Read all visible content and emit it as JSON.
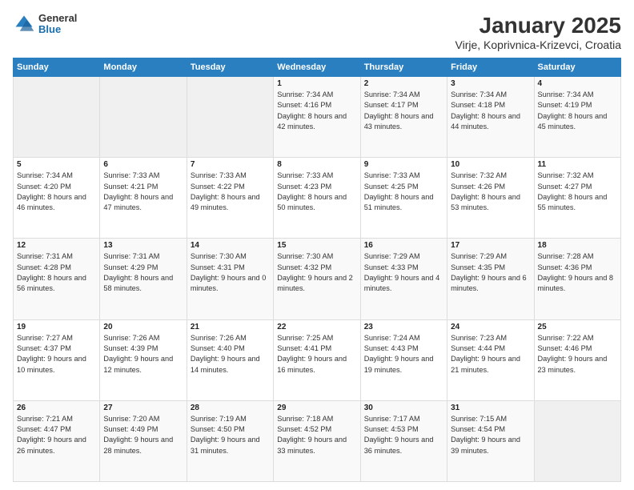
{
  "header": {
    "logo_general": "General",
    "logo_blue": "Blue",
    "title": "January 2025",
    "subtitle": "Virje, Koprivnica-Krizevci, Croatia"
  },
  "days_of_week": [
    "Sunday",
    "Monday",
    "Tuesday",
    "Wednesday",
    "Thursday",
    "Friday",
    "Saturday"
  ],
  "weeks": [
    [
      {
        "day": "",
        "info": ""
      },
      {
        "day": "",
        "info": ""
      },
      {
        "day": "",
        "info": ""
      },
      {
        "day": "1",
        "info": "Sunrise: 7:34 AM\nSunset: 4:16 PM\nDaylight: 8 hours and 42 minutes."
      },
      {
        "day": "2",
        "info": "Sunrise: 7:34 AM\nSunset: 4:17 PM\nDaylight: 8 hours and 43 minutes."
      },
      {
        "day": "3",
        "info": "Sunrise: 7:34 AM\nSunset: 4:18 PM\nDaylight: 8 hours and 44 minutes."
      },
      {
        "day": "4",
        "info": "Sunrise: 7:34 AM\nSunset: 4:19 PM\nDaylight: 8 hours and 45 minutes."
      }
    ],
    [
      {
        "day": "5",
        "info": "Sunrise: 7:34 AM\nSunset: 4:20 PM\nDaylight: 8 hours and 46 minutes."
      },
      {
        "day": "6",
        "info": "Sunrise: 7:33 AM\nSunset: 4:21 PM\nDaylight: 8 hours and 47 minutes."
      },
      {
        "day": "7",
        "info": "Sunrise: 7:33 AM\nSunset: 4:22 PM\nDaylight: 8 hours and 49 minutes."
      },
      {
        "day": "8",
        "info": "Sunrise: 7:33 AM\nSunset: 4:23 PM\nDaylight: 8 hours and 50 minutes."
      },
      {
        "day": "9",
        "info": "Sunrise: 7:33 AM\nSunset: 4:25 PM\nDaylight: 8 hours and 51 minutes."
      },
      {
        "day": "10",
        "info": "Sunrise: 7:32 AM\nSunset: 4:26 PM\nDaylight: 8 hours and 53 minutes."
      },
      {
        "day": "11",
        "info": "Sunrise: 7:32 AM\nSunset: 4:27 PM\nDaylight: 8 hours and 55 minutes."
      }
    ],
    [
      {
        "day": "12",
        "info": "Sunrise: 7:31 AM\nSunset: 4:28 PM\nDaylight: 8 hours and 56 minutes."
      },
      {
        "day": "13",
        "info": "Sunrise: 7:31 AM\nSunset: 4:29 PM\nDaylight: 8 hours and 58 minutes."
      },
      {
        "day": "14",
        "info": "Sunrise: 7:30 AM\nSunset: 4:31 PM\nDaylight: 9 hours and 0 minutes."
      },
      {
        "day": "15",
        "info": "Sunrise: 7:30 AM\nSunset: 4:32 PM\nDaylight: 9 hours and 2 minutes."
      },
      {
        "day": "16",
        "info": "Sunrise: 7:29 AM\nSunset: 4:33 PM\nDaylight: 9 hours and 4 minutes."
      },
      {
        "day": "17",
        "info": "Sunrise: 7:29 AM\nSunset: 4:35 PM\nDaylight: 9 hours and 6 minutes."
      },
      {
        "day": "18",
        "info": "Sunrise: 7:28 AM\nSunset: 4:36 PM\nDaylight: 9 hours and 8 minutes."
      }
    ],
    [
      {
        "day": "19",
        "info": "Sunrise: 7:27 AM\nSunset: 4:37 PM\nDaylight: 9 hours and 10 minutes."
      },
      {
        "day": "20",
        "info": "Sunrise: 7:26 AM\nSunset: 4:39 PM\nDaylight: 9 hours and 12 minutes."
      },
      {
        "day": "21",
        "info": "Sunrise: 7:26 AM\nSunset: 4:40 PM\nDaylight: 9 hours and 14 minutes."
      },
      {
        "day": "22",
        "info": "Sunrise: 7:25 AM\nSunset: 4:41 PM\nDaylight: 9 hours and 16 minutes."
      },
      {
        "day": "23",
        "info": "Sunrise: 7:24 AM\nSunset: 4:43 PM\nDaylight: 9 hours and 19 minutes."
      },
      {
        "day": "24",
        "info": "Sunrise: 7:23 AM\nSunset: 4:44 PM\nDaylight: 9 hours and 21 minutes."
      },
      {
        "day": "25",
        "info": "Sunrise: 7:22 AM\nSunset: 4:46 PM\nDaylight: 9 hours and 23 minutes."
      }
    ],
    [
      {
        "day": "26",
        "info": "Sunrise: 7:21 AM\nSunset: 4:47 PM\nDaylight: 9 hours and 26 minutes."
      },
      {
        "day": "27",
        "info": "Sunrise: 7:20 AM\nSunset: 4:49 PM\nDaylight: 9 hours and 28 minutes."
      },
      {
        "day": "28",
        "info": "Sunrise: 7:19 AM\nSunset: 4:50 PM\nDaylight: 9 hours and 31 minutes."
      },
      {
        "day": "29",
        "info": "Sunrise: 7:18 AM\nSunset: 4:52 PM\nDaylight: 9 hours and 33 minutes."
      },
      {
        "day": "30",
        "info": "Sunrise: 7:17 AM\nSunset: 4:53 PM\nDaylight: 9 hours and 36 minutes."
      },
      {
        "day": "31",
        "info": "Sunrise: 7:15 AM\nSunset: 4:54 PM\nDaylight: 9 hours and 39 minutes."
      },
      {
        "day": "",
        "info": ""
      }
    ]
  ]
}
